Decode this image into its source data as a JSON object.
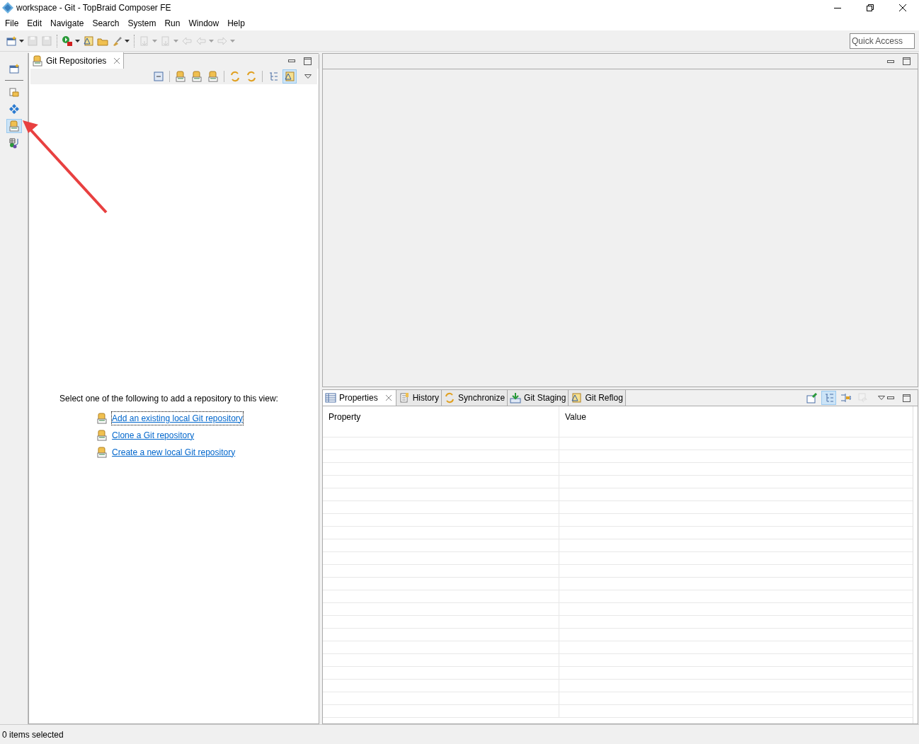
{
  "window": {
    "title": "workspace - Git - TopBraid Composer FE"
  },
  "menu": [
    "File",
    "Edit",
    "Navigate",
    "Search",
    "System",
    "Run",
    "Window",
    "Help"
  ],
  "toolbar": [
    {
      "disabled": false,
      "dropdown": true
    },
    {
      "disabled": true,
      "dropdown": false
    },
    {
      "disabled": true,
      "dropdown": false
    },
    {
      "disabled": false,
      "dropdown": true
    },
    {
      "disabled": false,
      "dropdown": false
    },
    {
      "disabled": false,
      "dropdown": false
    },
    {
      "disabled": false,
      "dropdown": true
    },
    {
      "disabled": true,
      "dropdown": true
    },
    {
      "disabled": true,
      "dropdown": true
    },
    {
      "disabled": true,
      "dropdown": false
    },
    {
      "disabled": true,
      "dropdown": true
    },
    {
      "disabled": true,
      "dropdown": true
    }
  ],
  "quick_access": {
    "placeholder": "Quick Access"
  },
  "side_trim": [
    {
      "selected": false
    },
    {
      "selected": false
    },
    {
      "selected": false
    },
    {
      "selected": true
    },
    {
      "selected": false
    }
  ],
  "repositories_view": {
    "tab": {
      "label": "Git Repositories",
      "selected": true
    },
    "toolbar": [
      {
        "selected": false
      },
      {
        "selected": false
      },
      {
        "selected": false
      },
      {
        "selected": false
      },
      {
        "selected": false
      },
      {
        "selected": false
      },
      {
        "selected": false
      },
      {
        "selected": true
      }
    ],
    "message": "Select one of the following to add a repository to this view:",
    "links": [
      {
        "label": "Add an existing local Git repository",
        "focused": true
      },
      {
        "label": "Clone a Git repository",
        "focused": false
      },
      {
        "label": "Create a new local Git repository",
        "focused": false
      }
    ]
  },
  "bottom_view": {
    "tabs": [
      {
        "label": "Properties",
        "selected": true
      },
      {
        "label": "History",
        "selected": false
      },
      {
        "label": "Synchronize",
        "selected": false
      },
      {
        "label": "Git Staging",
        "selected": false
      },
      {
        "label": "Git Reflog",
        "selected": false
      }
    ],
    "toolbar": [
      {
        "selected": false,
        "disabled": false
      },
      {
        "selected": true,
        "disabled": false
      },
      {
        "selected": false,
        "disabled": false
      },
      {
        "selected": false,
        "disabled": true
      }
    ],
    "table": {
      "columns": [
        "Property",
        "Value"
      ]
    }
  },
  "status_bar": {
    "text": "0 items selected"
  }
}
